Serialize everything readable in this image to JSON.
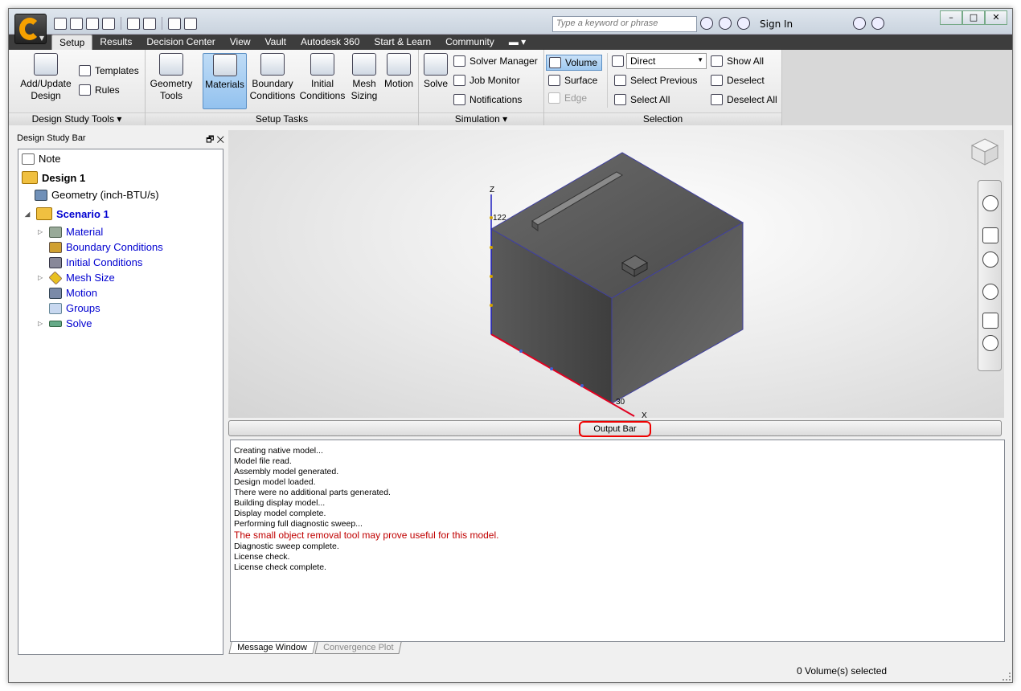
{
  "titlebar": {
    "search_placeholder": "Type a keyword or phrase",
    "sign_in": "Sign In"
  },
  "tabs": [
    "Setup",
    "Results",
    "Decision Center",
    "View",
    "Vault",
    "Autodesk 360",
    "Start & Learn",
    "Community"
  ],
  "ribbon": {
    "design_study_tools": {
      "label": "Design Study Tools",
      "add_update": "Add/Update",
      "design": "Design",
      "templates": "Templates",
      "rules": "Rules"
    },
    "setup_tasks": {
      "label": "Setup Tasks",
      "geometry": "Geometry",
      "tools": "Tools",
      "materials": "Materials",
      "boundary": "Boundary",
      "conditions": "Conditions",
      "initial": "Initial",
      "initial_conditions": "Conditions",
      "mesh": "Mesh",
      "sizing": "Sizing",
      "motion": "Motion"
    },
    "simulation": {
      "label": "Simulation",
      "solve": "Solve",
      "solver_manager": "Solver Manager",
      "job_monitor": "Job Monitor",
      "notifications": "Notifications"
    },
    "selection": {
      "label": "Selection",
      "volume": "Volume",
      "surface": "Surface",
      "edge": "Edge",
      "direct": "Direct",
      "select_previous": "Select Previous",
      "select_all": "Select All",
      "show_all": "Show All",
      "deselect": "Deselect",
      "deselect_all": "Deselect All"
    }
  },
  "design_study_bar": {
    "title": "Design Study Bar",
    "note": "Note",
    "design": "Design 1",
    "geometry": "Geometry (inch-BTU/s)",
    "scenario": "Scenario 1",
    "children": [
      "Material",
      "Boundary Conditions",
      "Initial Conditions",
      "Mesh Size",
      "Motion",
      "Groups",
      "Solve"
    ]
  },
  "viewport": {
    "axis_z": "Z",
    "axis_x": "X",
    "tick_z": "122",
    "tick_x": "30"
  },
  "output_bar": {
    "label": "Output Bar"
  },
  "messages": [
    "Creating native model...",
    "Model file read.",
    "Assembly model generated.",
    "Design model loaded.",
    "There were no additional parts generated.",
    "Building display model...",
    "Display model complete.",
    "Performing full diagnostic sweep..."
  ],
  "message_warning": "The small object removal tool may prove useful for this model.",
  "messages_after": [
    "Diagnostic sweep complete.",
    "License check.",
    "License check complete."
  ],
  "message_tabs": {
    "active": "Message Window",
    "inactive": "Convergence Plot"
  },
  "status": {
    "text": "0 Volume(s) selected"
  },
  "colors": {
    "accent": "#f5a000",
    "tabbar": "#3d3d3d",
    "warning": "#c00000",
    "link": "#0000d0"
  }
}
